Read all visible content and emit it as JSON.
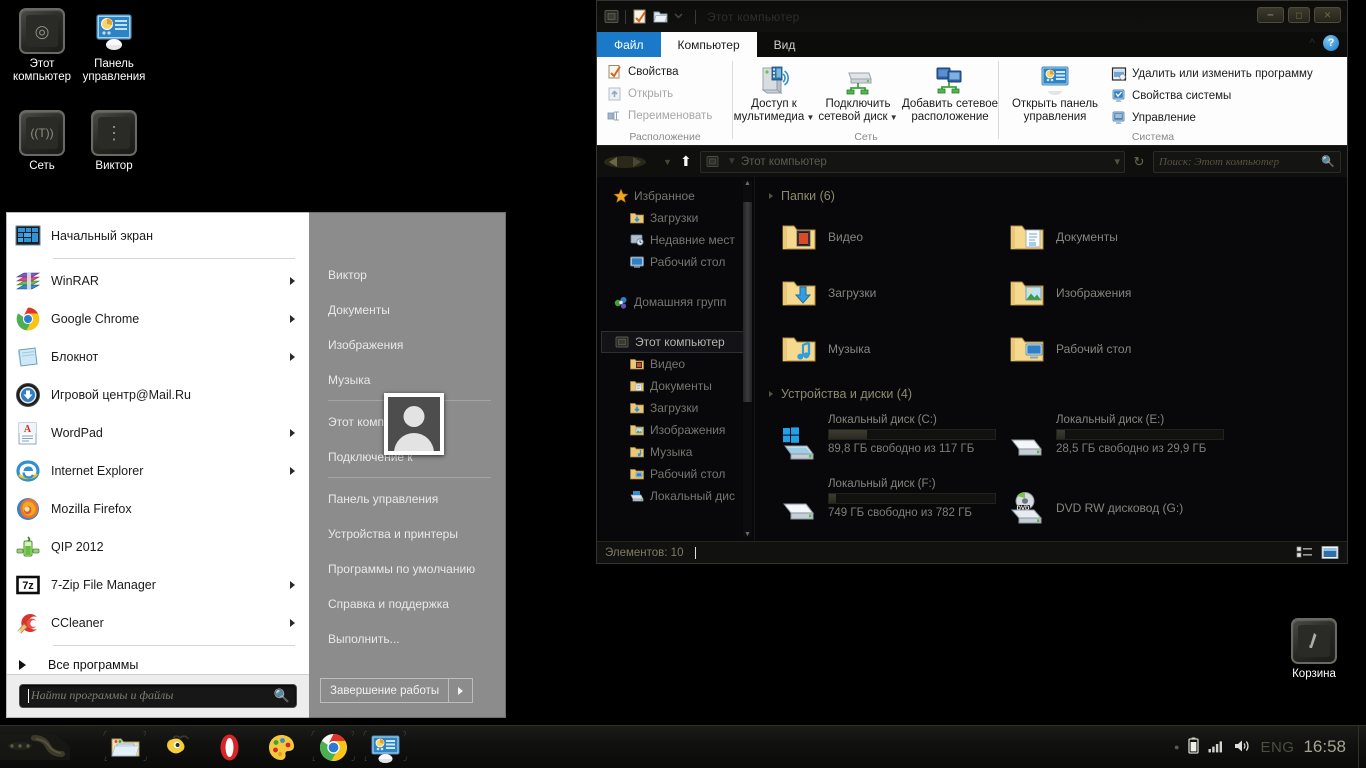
{
  "desktop": {
    "icons": [
      {
        "label": "Этот\nкомпьютер",
        "label_line1": "Этот",
        "label_line2": "компьютер",
        "name": "this-computer",
        "glyph": "⊕"
      },
      {
        "label": "Панель\nуправления",
        "label_line1": "Панель",
        "label_line2": "управления",
        "name": "control-panel",
        "glyph": ""
      },
      {
        "label": "Сеть",
        "label_line1": "Сеть",
        "label_line2": "",
        "name": "network",
        "glyph": "((T))"
      },
      {
        "label": "Виктор",
        "label_line1": "Виктор",
        "label_line2": "",
        "name": "user-folder",
        "glyph": "⋮"
      }
    ],
    "recycle_bin": {
      "label": "Корзина",
      "name": "recycle-bin"
    }
  },
  "start_menu": {
    "programs": [
      {
        "label": "Начальный экран",
        "icon": "start-screen-tiles-icon",
        "arrow": false
      },
      {
        "label": "WinRAR",
        "icon": "winrar-icon",
        "arrow": true
      },
      {
        "label": "Google Chrome",
        "icon": "chrome-icon",
        "arrow": true
      },
      {
        "label": "Блокнот",
        "icon": "notepad-icon",
        "arrow": true
      },
      {
        "label": "Игровой центр@Mail.Ru",
        "icon": "mailru-gamecenter-icon",
        "arrow": false
      },
      {
        "label": "WordPad",
        "icon": "wordpad-icon",
        "arrow": true
      },
      {
        "label": "Internet Explorer",
        "icon": "internet-explorer-icon",
        "arrow": true
      },
      {
        "label": "Mozilla Firefox",
        "icon": "firefox-icon",
        "arrow": false
      },
      {
        "label": "QIP 2012",
        "icon": "qip-icon",
        "arrow": false
      },
      {
        "label": "7-Zip File Manager",
        "icon": "sevenzip-icon",
        "arrow": true
      },
      {
        "label": "CCleaner",
        "icon": "ccleaner-icon",
        "arrow": true
      }
    ],
    "all_programs_label": "Все программы",
    "search_placeholder": "Найти программы и файлы",
    "user_name": "Виктор",
    "right_items": [
      {
        "label": "Виктор"
      },
      {
        "label": "Документы"
      },
      {
        "label": "Изображения"
      },
      {
        "label": "Музыка"
      },
      {
        "label": "Этот компьютер"
      },
      {
        "label": "Подключение к"
      },
      {
        "label": "Панель управления"
      },
      {
        "label": "Устройства и принтеры"
      },
      {
        "label": "Программы по умолчанию"
      },
      {
        "label": "Справка и поддержка"
      },
      {
        "label": "Выполнить..."
      }
    ],
    "shutdown_label": "Завершение работы"
  },
  "explorer": {
    "title": "Этот компьютер",
    "tabs": [
      {
        "label": "Файл",
        "state": "file"
      },
      {
        "label": "Компьютер",
        "state": "active"
      },
      {
        "label": "Вид",
        "state": "inactive"
      }
    ],
    "ribbon": {
      "groups": [
        {
          "title": "Расположение",
          "name": "location-group",
          "small_commands": [
            {
              "label": "Свойства",
              "icon": "properties-icon",
              "enabled": true
            },
            {
              "label": "Открыть",
              "icon": "open-icon",
              "enabled": false
            },
            {
              "label": "Переименовать",
              "icon": "rename-icon",
              "enabled": false
            }
          ]
        },
        {
          "title": "Сеть",
          "name": "network-group",
          "big_commands": [
            {
              "label_line1": "Доступ к",
              "label_line2": "мультимедиа",
              "dropdown": true,
              "icon": "media-access-icon"
            },
            {
              "label_line1": "Подключить",
              "label_line2": "сетевой диск",
              "dropdown": true,
              "icon": "map-network-drive-icon"
            },
            {
              "label_line1": "Добавить сетевое",
              "label_line2": "расположение",
              "dropdown": false,
              "icon": "add-network-location-icon"
            }
          ]
        },
        {
          "title": "Система",
          "name": "system-group",
          "big_commands": [
            {
              "label_line1": "Открыть панель",
              "label_line2": "управления",
              "dropdown": false,
              "icon": "open-control-panel-icon"
            }
          ],
          "small_commands": [
            {
              "label": "Удалить или изменить программу",
              "icon": "uninstall-program-icon",
              "enabled": true
            },
            {
              "label": "Свойства системы",
              "icon": "system-properties-icon",
              "enabled": true
            },
            {
              "label": "Управление",
              "icon": "manage-icon",
              "enabled": true
            }
          ]
        }
      ]
    },
    "address": {
      "crumb": "Этот компьютер",
      "search_placeholder": "Поиск: Этот компьютер"
    },
    "tree": [
      {
        "label": "Избранное",
        "level": 1,
        "icon": "star-icon",
        "selected": false
      },
      {
        "label": "Загрузки",
        "level": 2,
        "icon": "downloads-folder-icon",
        "selected": false
      },
      {
        "label": "Недавние мест",
        "level": 2,
        "icon": "recent-places-icon",
        "selected": false
      },
      {
        "label": "Рабочий стол",
        "level": 2,
        "icon": "desktop-icon",
        "selected": false
      },
      {
        "label": "Домашняя групп",
        "level": 1,
        "icon": "homegroup-icon",
        "selected": false
      },
      {
        "label": "Этот компьютер",
        "level": 1,
        "icon": "computer-icon",
        "selected": true
      },
      {
        "label": "Видео",
        "level": 2,
        "icon": "videos-folder-icon",
        "selected": false
      },
      {
        "label": "Документы",
        "level": 2,
        "icon": "documents-folder-icon",
        "selected": false
      },
      {
        "label": "Загрузки",
        "level": 2,
        "icon": "downloads-folder-icon",
        "selected": false
      },
      {
        "label": "Изображения",
        "level": 2,
        "icon": "pictures-folder-icon",
        "selected": false
      },
      {
        "label": "Музыка",
        "level": 2,
        "icon": "music-folder-icon",
        "selected": false
      },
      {
        "label": "Рабочий стол",
        "level": 2,
        "icon": "desktop-folder-icon",
        "selected": false
      },
      {
        "label": "Локальный дис",
        "level": 2,
        "icon": "local-disk-icon",
        "selected": false
      }
    ],
    "groups": [
      {
        "header": "Папки (6)",
        "name": "folders-group",
        "items": [
          {
            "label": "Видео",
            "icon": "videos-folder-icon"
          },
          {
            "label": "Документы",
            "icon": "documents-folder-icon"
          },
          {
            "label": "Загрузки",
            "icon": "downloads-folder-icon"
          },
          {
            "label": "Изображения",
            "icon": "pictures-folder-icon"
          },
          {
            "label": "Музыка",
            "icon": "music-folder-icon"
          },
          {
            "label": "Рабочий стол",
            "icon": "desktop-folder-icon"
          }
        ]
      }
    ],
    "devices_header": "Устройства и диски (4)",
    "drives": [
      {
        "label": "Локальный диск (C:)",
        "free_text": "89,8 ГБ свободно из 117 ГБ",
        "used_pct": 23,
        "icon": "windows-drive-icon",
        "has_bar": true
      },
      {
        "label": "Локальный диск (E:)",
        "free_text": "28,5 ГБ свободно из 29,9 ГБ",
        "used_pct": 5,
        "icon": "hard-drive-icon",
        "has_bar": true
      },
      {
        "label": "Локальный диск (F:)",
        "free_text": "749 ГБ свободно из 782 ГБ",
        "used_pct": 4,
        "icon": "hard-drive-icon",
        "has_bar": true
      },
      {
        "label": "DVD RW дисковод (G:)",
        "free_text": "",
        "used_pct": 0,
        "icon": "dvd-drive-icon",
        "has_bar": false
      }
    ],
    "status": "Элементов: 10"
  },
  "taskbar": {
    "apps": [
      {
        "name": "file-explorer",
        "icon": "folder-icon",
        "pinned": true
      },
      {
        "name": "mail-agent",
        "icon": "mail-agent-icon",
        "pinned": false
      },
      {
        "name": "opera",
        "icon": "opera-icon",
        "pinned": false
      },
      {
        "name": "paint",
        "icon": "paint-icon",
        "pinned": false
      },
      {
        "name": "chrome",
        "icon": "chrome-icon",
        "pinned": true
      },
      {
        "name": "control-panel",
        "icon": "control-panel-icon",
        "pinned": true
      }
    ],
    "tray": {
      "language": "ENG",
      "clock": "16:58"
    }
  },
  "colors": {
    "accent": "#1a7ac9",
    "ribbon_bg": "#fdfdfd",
    "window_bg": "#08080a",
    "taskbar_bg": "#111110"
  }
}
